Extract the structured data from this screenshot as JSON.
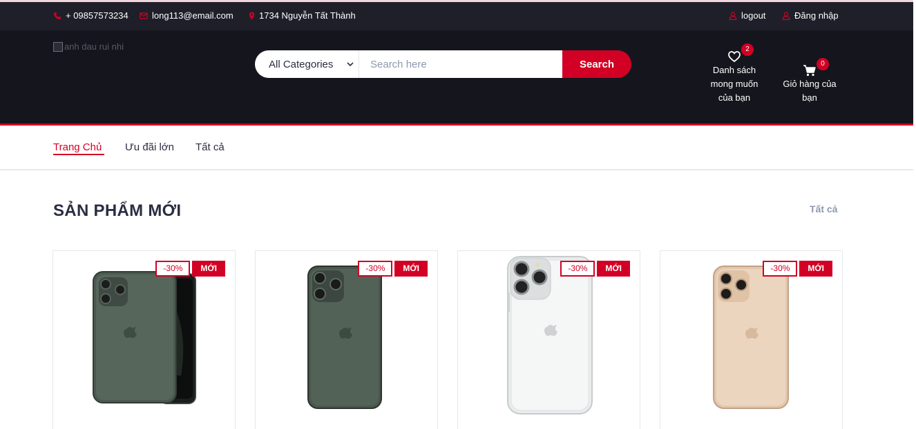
{
  "topbar": {
    "phone": "+ 09857573234",
    "email": "long113@email.com",
    "address": "1734 Nguyễn Tất Thành",
    "logout": "logout",
    "login": "Đăng nhập"
  },
  "header": {
    "logo_alt": "anh dau rui nhi",
    "search": {
      "category_selected": "All Categories",
      "placeholder": "Search here",
      "button": "Search"
    },
    "wishlist": {
      "label_line1": "Danh sách",
      "label_line2": "mong muốn",
      "label_line3": "của bạn",
      "count": "2"
    },
    "cart": {
      "label_line1": "Giỏ hàng của",
      "label_line2": "bạn",
      "count": "0"
    }
  },
  "nav": {
    "items": [
      {
        "label": "Trang Chủ",
        "active": true
      },
      {
        "label": "Ưu đãi lớn",
        "active": false
      },
      {
        "label": "Tất cả",
        "active": false
      }
    ]
  },
  "section": {
    "title": "SẢN PHẨM MỚI",
    "view_all": "Tất cả"
  },
  "products": [
    {
      "sale": "-30%",
      "new": "MỚI",
      "image": "iphone-11-pro-midnight-green-front-back"
    },
    {
      "sale": "-30%",
      "new": "MỚI",
      "image": "iphone-11-pro-midnight-green-back"
    },
    {
      "sale": "-30%",
      "new": "MỚI",
      "image": "iphone-11-pro-clear-case"
    },
    {
      "sale": "-30%",
      "new": "MỚI",
      "image": "iphone-11-pro-gold-back"
    }
  ],
  "colors": {
    "accent": "#d10024",
    "dark": "#15161d",
    "topbar": "#1e1f29",
    "text": "#2b2d42",
    "muted": "#8d99ae"
  }
}
